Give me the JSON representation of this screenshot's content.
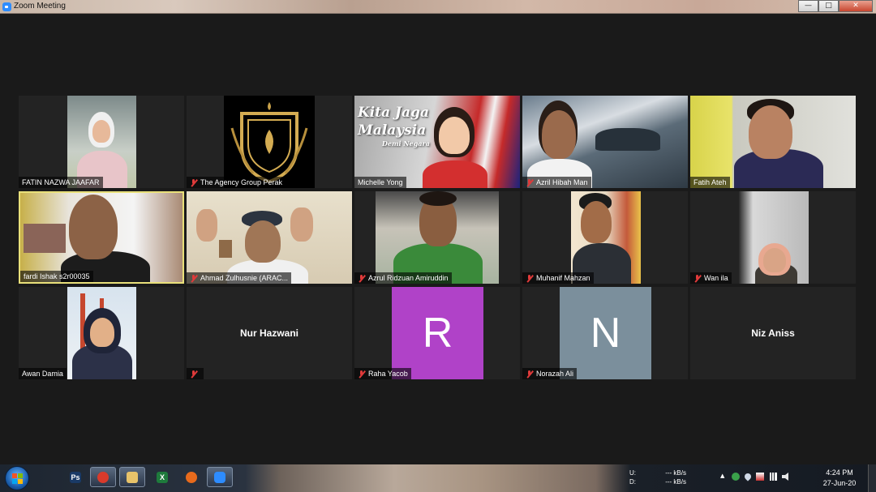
{
  "window": {
    "title": "Zoom Meeting",
    "minimize_glyph": "—",
    "maximize_glyph": "□",
    "close_glyph": "✕"
  },
  "tiles": [
    {
      "name": "FATIN NAZWA JAAFAR",
      "muted": false
    },
    {
      "name": "The Agency Group Perak",
      "muted": true
    },
    {
      "name": "Michelle Yong",
      "muted": false,
      "banner": [
        "Kita Jaga",
        "Malaysia",
        "Demi Negara"
      ]
    },
    {
      "name": "Azril Hibah Man",
      "muted": true
    },
    {
      "name": "Fatih Ateh",
      "muted": false
    },
    {
      "name": "fardi Ishak s2r00035",
      "muted": false,
      "active": true
    },
    {
      "name": "Ahmad Zulhusnie (ARAC...",
      "muted": true
    },
    {
      "name": "Azrul Ridzuan Amiruddin",
      "muted": true
    },
    {
      "name": "Muhanif Mahzan",
      "muted": true
    },
    {
      "name": "Wan ila",
      "muted": true
    },
    {
      "name": "Awan Damia",
      "muted": false
    },
    {
      "name": "",
      "display_name": "Nur Hazwani",
      "muted": true
    },
    {
      "name": "Raha Yacob",
      "muted": true,
      "initial": "R",
      "avatar_color": "#b042c8"
    },
    {
      "name": "Norazah Ali",
      "muted": true,
      "initial": "N",
      "avatar_color": "#7b8f9c"
    },
    {
      "name": "",
      "display_name": "Niz Aniss",
      "muted": false
    }
  ],
  "taskbar": {
    "apps": [
      {
        "name": "photoshop",
        "glyph": "Ps",
        "color": "#1a3a66"
      },
      {
        "name": "chrome",
        "glyph": "",
        "color": "#d93a2b"
      },
      {
        "name": "file-explorer",
        "glyph": "",
        "color": "#e8c36a"
      },
      {
        "name": "excel",
        "glyph": "X",
        "color": "#1e7a3c"
      },
      {
        "name": "firefox",
        "glyph": "",
        "color": "#e86a1c"
      },
      {
        "name": "zoom",
        "glyph": "",
        "color": "#2d8cff"
      }
    ],
    "network": {
      "up_label": "U:",
      "down_label": "D:",
      "up_value": "--- kB/s",
      "down_value": "--- kB/s"
    },
    "clock": {
      "time": "4:24 PM",
      "date": "27-Jun-20"
    },
    "tray_arrow": "▲"
  }
}
